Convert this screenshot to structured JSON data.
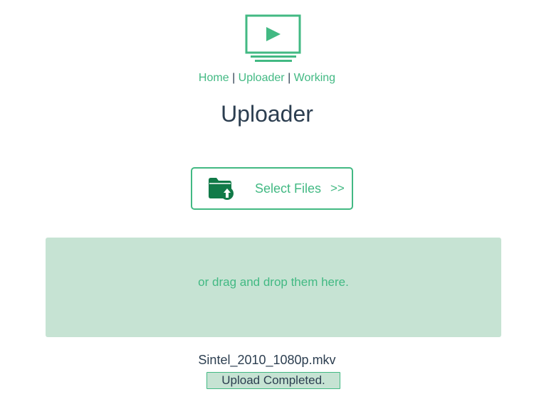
{
  "logo": {
    "icon": "tv-play-icon"
  },
  "nav": {
    "items": [
      {
        "label": "Home"
      },
      {
        "label": "Uploader"
      },
      {
        "label": "Working"
      }
    ],
    "separator": "|"
  },
  "page": {
    "title": "Uploader"
  },
  "select_button": {
    "icon": "folder-upload-icon",
    "label": "Select Files",
    "arrows": ">>"
  },
  "dropzone": {
    "hint": "or drag and drop them here."
  },
  "upload": {
    "filename": "Sintel_2010_1080p.mkv",
    "status": "Upload Completed."
  },
  "colors": {
    "accent": "#42b983",
    "text": "#2c3e50",
    "dropzone_bg": "#c6e3d3",
    "icon_dark": "#117a48"
  }
}
